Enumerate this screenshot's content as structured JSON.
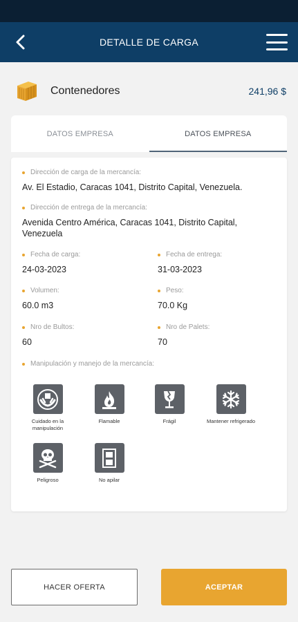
{
  "header": {
    "title": "DETALLE DE CARGA",
    "back_icon": "chevron-left-icon",
    "menu_icon": "hamburger-menu-icon"
  },
  "cargo": {
    "icon": "container-box-icon",
    "type": "Contenedores",
    "price": "241,96 $"
  },
  "tabs": [
    {
      "label": "DATOS  EMPRESA",
      "active": false
    },
    {
      "label": "DATOS EMPRESA",
      "active": true
    }
  ],
  "details": {
    "pickup_address": {
      "label": "Dirección de carga de la mercancía:",
      "value": "Av. El Estadio, Caracas 1041, Distrito Capital, Venezuela."
    },
    "delivery_address": {
      "label": "Dirección de entrega de la mercancía:",
      "value": "Avenida Centro América, Caracas 1041, Distrito Capital, Venezuela"
    },
    "pickup_date": {
      "label": "Fecha de carga:",
      "value": "24-03-2023"
    },
    "delivery_date": {
      "label": "Fecha de entrega:",
      "value": "31-03-2023"
    },
    "volume": {
      "label": "Volumen:",
      "value": "60.0 m3"
    },
    "weight": {
      "label": "Peso:",
      "value": "70.0 Kg"
    },
    "packages": {
      "label": "Nro de Bultos:",
      "value": "60"
    },
    "pallets": {
      "label": "Nro de Palets:",
      "value": "70"
    },
    "handling_label": "Manipulación y manejo de la mercancía:"
  },
  "handling": [
    {
      "icon": "hands-care-icon",
      "label": "Cuidado en la manipulación"
    },
    {
      "icon": "flame-icon",
      "label": "Flamable"
    },
    {
      "icon": "fragile-glass-icon",
      "label": "Frágil"
    },
    {
      "icon": "snowflake-icon",
      "label": "Mantener refrigerado"
    },
    {
      "icon": "skull-crossbones-icon",
      "label": "Peligroso"
    },
    {
      "icon": "no-stack-icon",
      "label": "No apilar"
    }
  ],
  "actions": {
    "offer_label": "HACER OFERTA",
    "accept_label": "ACEPTAR"
  },
  "colors": {
    "header": "#0e3e66",
    "status_bar": "#0b1f33",
    "accent": "#e8a530",
    "icon_tile": "#5d6167"
  }
}
